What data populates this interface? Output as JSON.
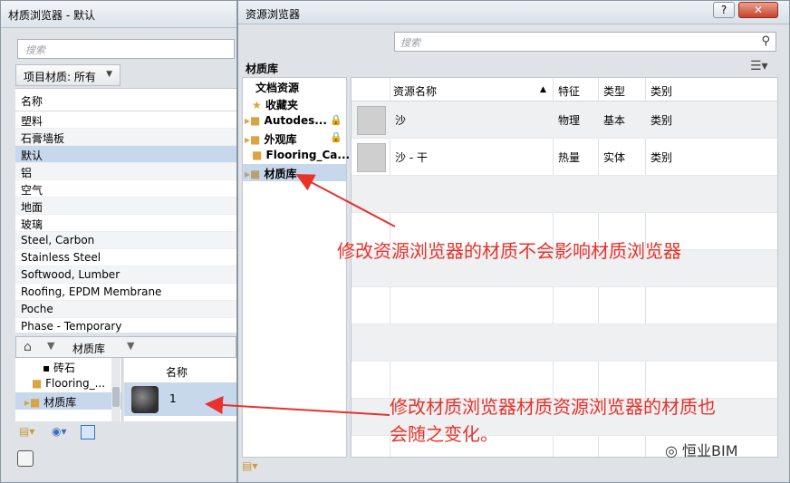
{
  "material_browser": {
    "title": "材质浏览器 - 默认",
    "search_placeholder": "搜索",
    "filter_label": "项目材质: 所有",
    "list_header": "名称",
    "materials": [
      "塑料",
      "石膏墙板",
      "默认",
      "铝",
      "空气",
      "地面",
      "玻璃",
      "Steel, Carbon",
      "Stainless Steel",
      "Softwood, Lumber",
      "Roofing, EPDM Membrane",
      "Poche",
      "Phase - Temporary"
    ],
    "selected_material": "默认",
    "breadcrumb": "材质库",
    "library_tree": [
      "砖石",
      "Flooring_...",
      "材质库"
    ],
    "asset_header": "名称",
    "asset_item": "1"
  },
  "asset_browser": {
    "title": "资源浏览器",
    "help_label": "?",
    "close_label": "✕",
    "search_placeholder": "搜索",
    "section_title": "材质库",
    "tree": [
      {
        "label": "文档资源"
      },
      {
        "label": "收藏夹"
      },
      {
        "label": "Autodes..."
      },
      {
        "label": "外观库"
      },
      {
        "label": "Flooring_Ca..."
      },
      {
        "label": "材质库"
      }
    ],
    "columns": [
      "资源名称",
      "特征",
      "类型",
      "类别"
    ],
    "rows": [
      {
        "name": "沙",
        "feature": "物理",
        "type": "基本",
        "category": "类别"
      },
      {
        "name": "沙 - 干",
        "feature": "热量",
        "type": "实体",
        "category": "类别"
      }
    ]
  },
  "annotations": {
    "note1": "修改资源浏览器的材质不会影响材质浏览器",
    "note2_line1": "修改材质浏览器材质资源浏览器的材质也",
    "note2_line2": "会随之变化。",
    "color": "#e8322a"
  },
  "watermark": "恒业BIM"
}
